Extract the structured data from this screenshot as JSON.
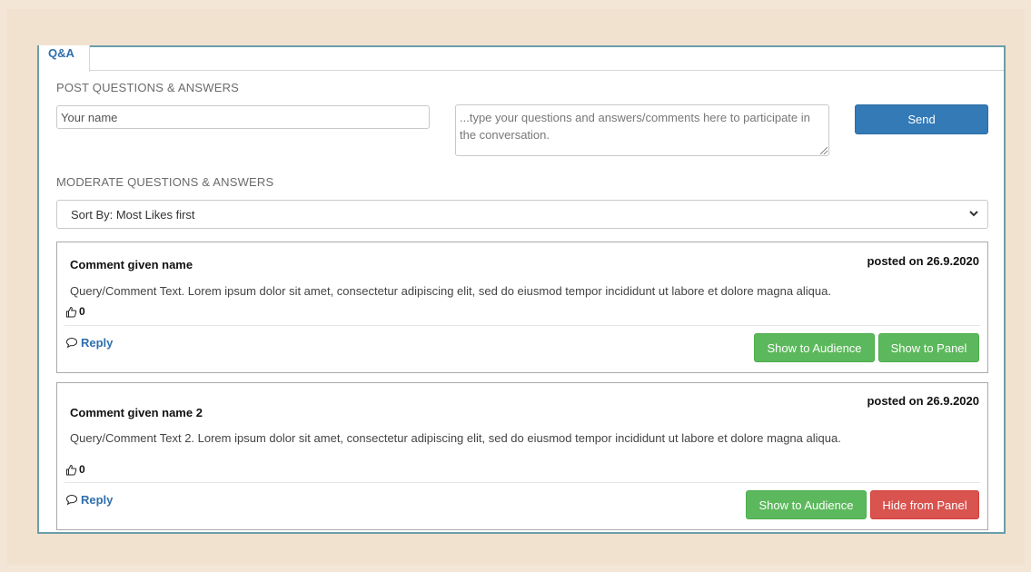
{
  "tab": {
    "label": "Q&A"
  },
  "post": {
    "section_title": "POST QUESTIONS & ANSWERS",
    "name_placeholder": "Your name",
    "message_placeholder": "...type your questions and answers/comments here to participate in the conversation.",
    "send_label": "Send"
  },
  "moderate": {
    "section_title": "MODERATE QUESTIONS & ANSWERS",
    "sort_value": "Sort By: Most Likes first"
  },
  "comments": [
    {
      "name": "Comment given name",
      "date": "posted on 26.9.2020",
      "text": "Query/Comment Text. Lorem ipsum dolor sit amet, consectetur adipiscing elit, sed do eiusmod tempor incididunt ut labore et dolore magna aliqua.",
      "likes": "0",
      "reply_label": "Reply",
      "audience_label": "Show to Audience",
      "panel_label": "Show to Panel"
    },
    {
      "name": "Comment given name 2",
      "date": "posted on 26.9.2020",
      "text": "Query/Comment Text 2. Lorem ipsum dolor sit amet, consectetur adipiscing elit, sed do eiusmod tempor incididunt ut labore et dolore magna aliqua.",
      "likes": "0",
      "reply_label": "Reply",
      "audience_label": "Show to Audience",
      "panel_label": "Hide from Panel"
    }
  ],
  "colors": {
    "primary": "#337ab7",
    "success": "#5cb85c",
    "danger": "#d9534f",
    "link": "#2f6fae"
  },
  "icons": {
    "like": "thumbs-up-icon",
    "reply": "speech-bubble-icon",
    "sort": "chevron-down-icon"
  }
}
